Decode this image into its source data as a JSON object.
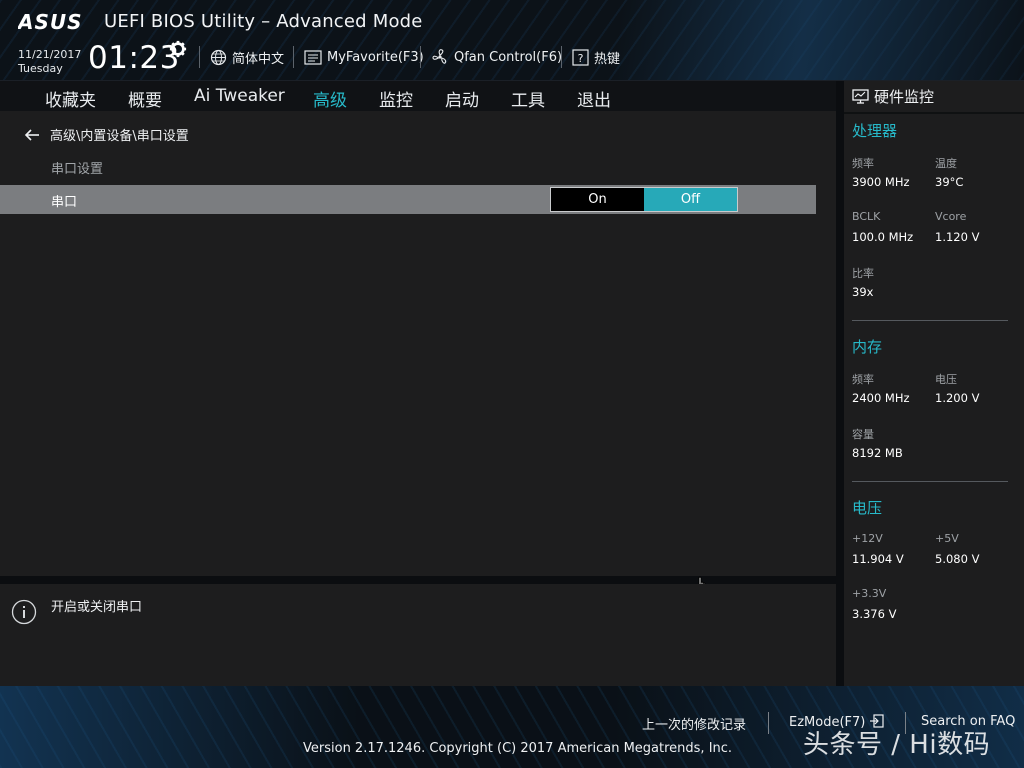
{
  "header": {
    "brand": "ASUS",
    "title": "UEFI BIOS Utility – Advanced Mode",
    "date": "11/21/2017",
    "weekday": "Tuesday",
    "time": "01:23",
    "tools": {
      "language": "简体中文",
      "myfavorite": "MyFavorite(F3)",
      "qfan": "Qfan Control(F6)",
      "hotkeys": "热键"
    }
  },
  "menu": {
    "items": [
      "收藏夹",
      "概要",
      "Ai Tweaker",
      "高级",
      "监控",
      "启动",
      "工具",
      "退出"
    ],
    "active": "高级"
  },
  "main": {
    "breadcrumb": "高级\\内置设备\\串口设置",
    "section_label": "串口设置",
    "setting": {
      "label": "串口",
      "options": [
        "On",
        "Off"
      ],
      "selected": "Off"
    }
  },
  "help": {
    "text": "开启或关闭串口"
  },
  "monitor": {
    "title": "硬件监控",
    "cpu": {
      "title": "处理器",
      "freq_label": "频率",
      "freq": "3900 MHz",
      "temp_label": "温度",
      "temp": "39°C",
      "bclk_label": "BCLK",
      "bclk": "100.0 MHz",
      "vcore_label": "Vcore",
      "vcore": "1.120 V",
      "ratio_label": "比率",
      "ratio": "39x"
    },
    "memory": {
      "title": "内存",
      "freq_label": "频率",
      "freq": "2400 MHz",
      "volt_label": "电压",
      "volt": "1.200 V",
      "cap_label": "容量",
      "cap": "8192 MB"
    },
    "voltage": {
      "title": "电压",
      "v12_label": "+12V",
      "v12": "11.904 V",
      "v5_label": "+5V",
      "v5": "5.080 V",
      "v33_label": "+3.3V",
      "v33": "3.376 V"
    }
  },
  "footer": {
    "last_modified": "上一次的修改记录",
    "ezmode": "EzMode(F7)",
    "search_faq": "Search on FAQ",
    "copyright": "Version 2.17.1246. Copyright (C) 2017 American Megatrends, Inc.",
    "watermark": "头条号 / Hi数码"
  },
  "colors": {
    "accent": "#27b9c9",
    "toggle_selected": "#27a9b8",
    "selected_row": "#7b7d80",
    "panel": "#1d1d1e"
  }
}
